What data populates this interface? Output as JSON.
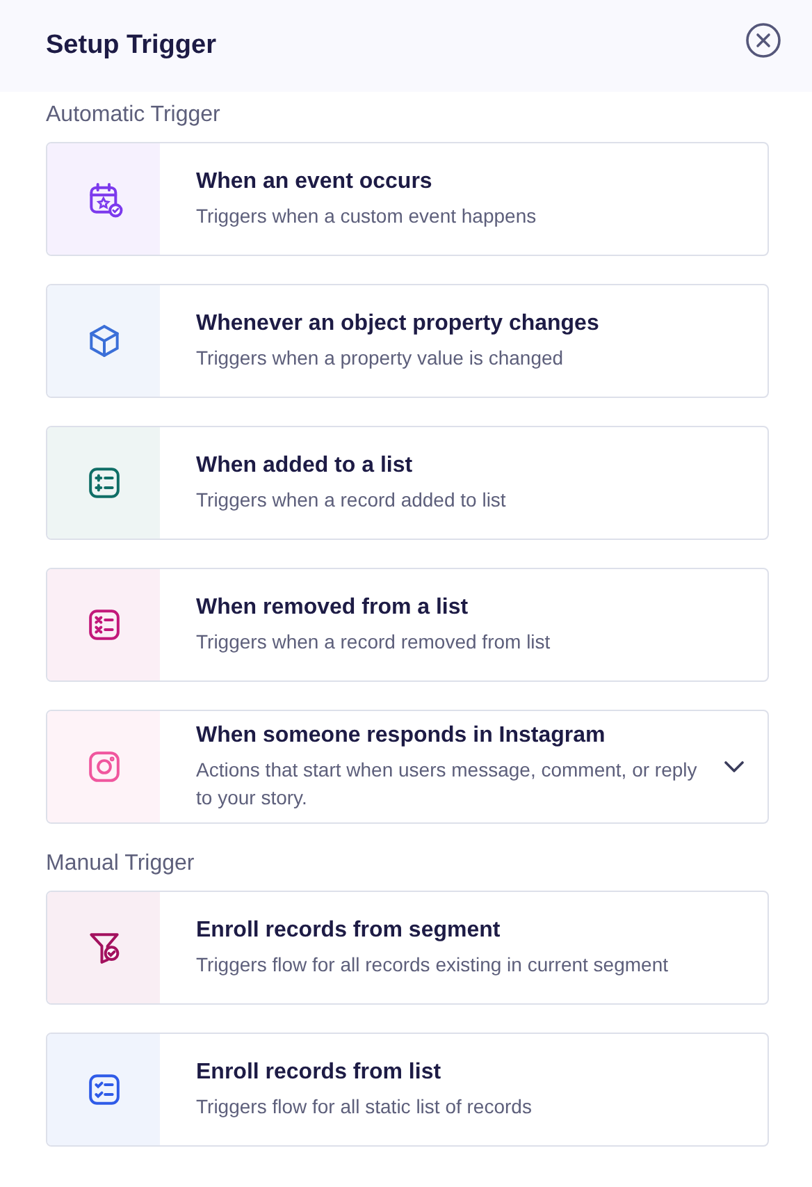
{
  "header": {
    "title": "Setup Trigger"
  },
  "sections": [
    {
      "label": "Automatic Trigger",
      "triggers": [
        {
          "kind": "calendar",
          "color": "#7c3aed",
          "title": "When an event occurs",
          "description": "Triggers when a custom event happens"
        },
        {
          "kind": "cube",
          "color": "#3b6fd8",
          "title": "Whenever an object property changes",
          "description": "Triggers when a property value is changed"
        },
        {
          "kind": "list-add",
          "color": "#0f6e66",
          "title": "When added to a list",
          "description": "Triggers when a record added to list"
        },
        {
          "kind": "list-remove",
          "color": "#c2187a",
          "title": "When removed from a list",
          "description": "Triggers when a record removed from list"
        },
        {
          "kind": "instagram",
          "color": "#f0569e",
          "title": "When someone responds in Instagram",
          "description": "Actions that start when users message, comment, or reply to your story.",
          "expanded": false
        }
      ]
    },
    {
      "label": "Manual Trigger",
      "triggers": [
        {
          "kind": "funnel",
          "color": "#a3115e",
          "title": "Enroll records from segment",
          "description": "Triggers flow for all records existing in current segment"
        },
        {
          "kind": "checklist",
          "color": "#2f5be8",
          "title": "Enroll records from list",
          "description": "Triggers flow for all static list of records"
        }
      ]
    }
  ]
}
